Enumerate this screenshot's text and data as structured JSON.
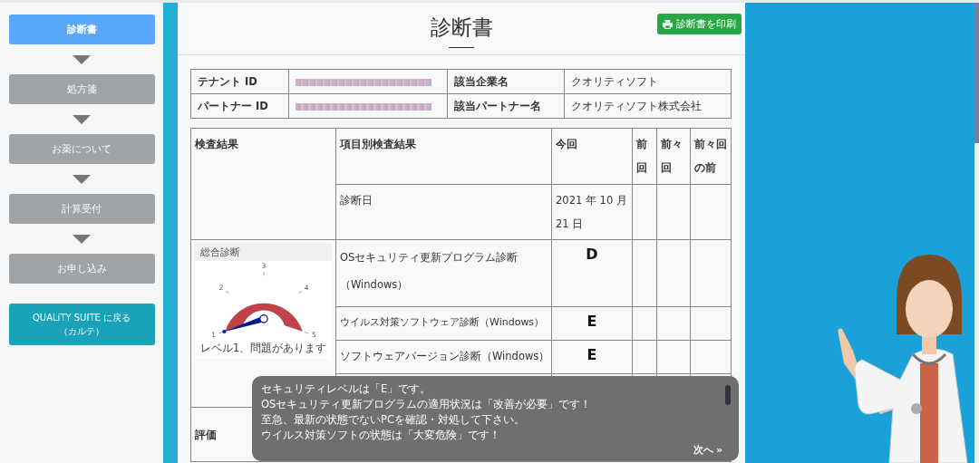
{
  "sidebar": {
    "steps": [
      {
        "label": "診断書",
        "selected": true
      },
      {
        "label": "処方箋",
        "selected": false
      },
      {
        "label": "お薬について",
        "selected": false
      },
      {
        "label": "計算受付",
        "selected": false
      },
      {
        "label": "お申し込み",
        "selected": false
      }
    ],
    "back_button": "QUALiTY SUITE に戻る（カルテ）"
  },
  "header": {
    "title": "診断書",
    "print_button": "診断書を印刷"
  },
  "info_table": {
    "rows": [
      {
        "label": "テナント ID",
        "field": "該当企業名",
        "value": "クオリティソフト"
      },
      {
        "label": "パートナー ID",
        "field": "該当パートナー名",
        "value": "クオリティソフト株式会社"
      }
    ]
  },
  "results_table": {
    "columns": [
      "検査結果",
      "項目別検査結果",
      "今回",
      "前回",
      "前々回",
      "前々回の前"
    ],
    "date_row": {
      "label": "診断日",
      "value": "2021 年 10 月 21 日"
    },
    "gauge": {
      "title": "総合診断",
      "ticks": [
        "1",
        "2",
        "3",
        "4",
        "5"
      ],
      "level": 0,
      "caption": "レベル1、問題があります"
    },
    "rows": [
      {
        "label": "OSセキュリティ更新プログラム診断（Windows）",
        "grade": "D"
      },
      {
        "label": "ウイルス対策ソフトウェア診断（Windows）",
        "grade": "E"
      },
      {
        "label": "ソフトウェアバージョン診断（Windows）",
        "grade": "E"
      }
    ],
    "rating_label": "評価"
  },
  "message": {
    "lines": [
      "セキュリティレベルは「E」です。",
      "OSセキュリティ更新プログラムの適用状況は「改善が必要」です！",
      "至急、最新の状態でないPCを確認・対処して下さい。",
      "ウイルス対策ソフトの状態は「大変危険」です！"
    ],
    "next_button": "次へ »"
  }
}
